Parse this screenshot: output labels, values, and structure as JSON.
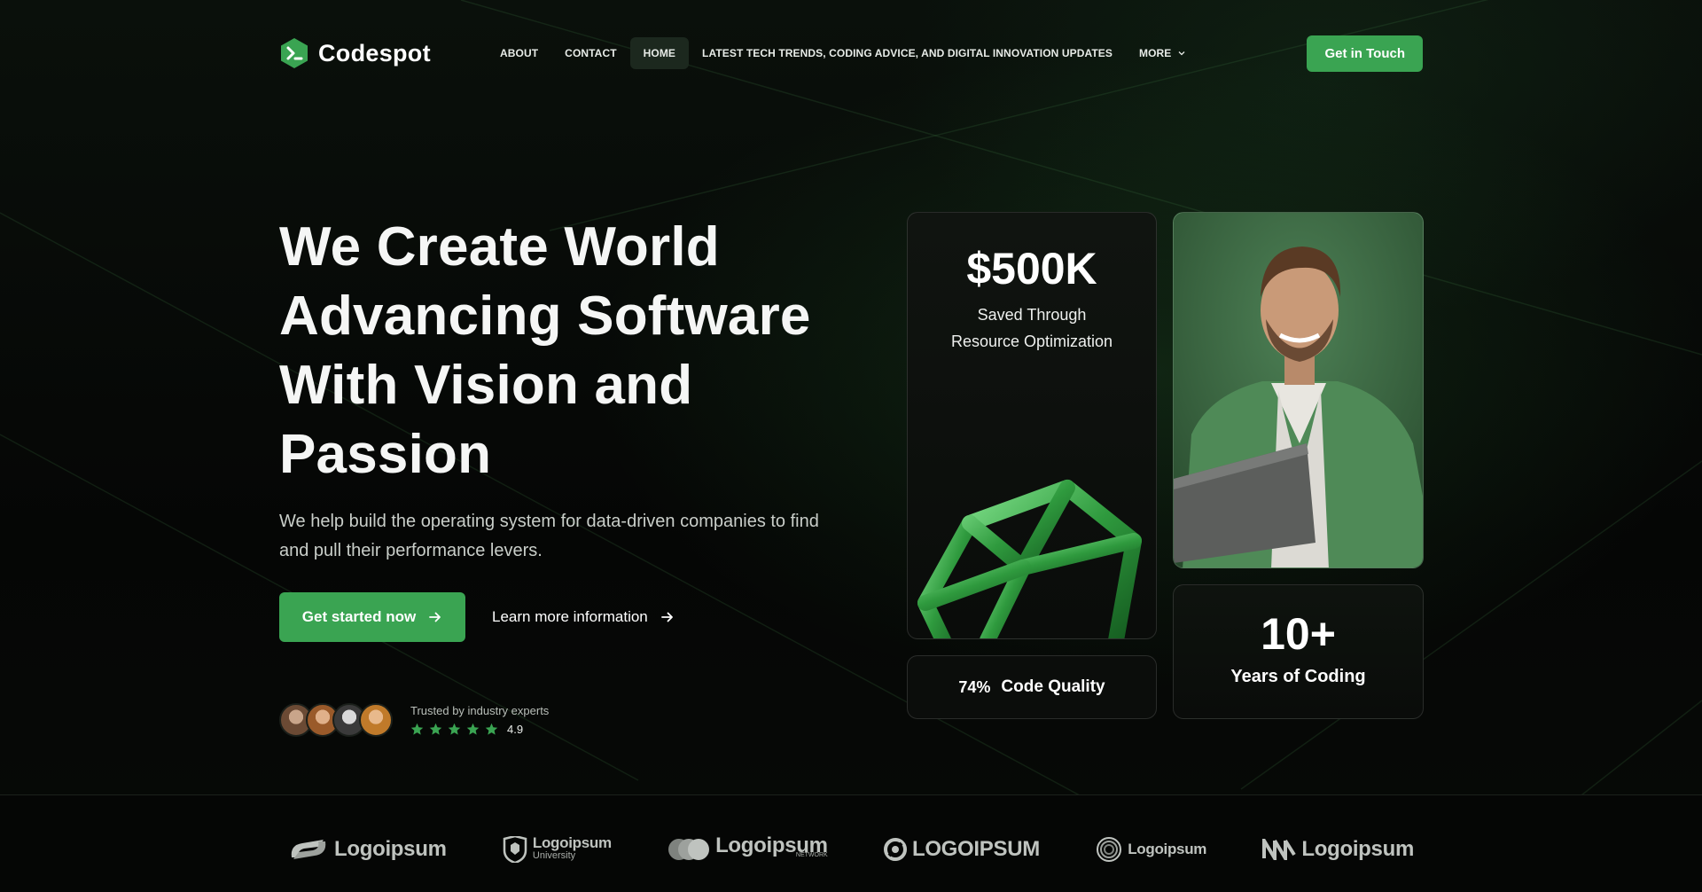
{
  "nav": {
    "logo_text": "Codespot",
    "items": [
      {
        "label": "ABOUT"
      },
      {
        "label": "CONTACT"
      },
      {
        "label": "HOME",
        "active": true
      },
      {
        "label": "LATEST TECH TRENDS, CODING ADVICE, AND DIGITAL INNOVATION UPDATES"
      },
      {
        "label": "MORE"
      }
    ],
    "cta": "Get in Touch"
  },
  "hero": {
    "title_lines": [
      "We Create World",
      "Advancing Software",
      "With Vision and",
      "Passion"
    ],
    "subtitle_lines": [
      "We help build the operating system for data-driven companies to find",
      "and pull their performance levers."
    ],
    "primary_button": "Get started now",
    "secondary_link": "Learn more information",
    "trust_label": "Trusted by industry experts",
    "rating": "4.9",
    "stars": 5
  },
  "stats": {
    "money_value": "$500K",
    "money_label_lines": [
      "Saved Through",
      "Resource Optimization"
    ],
    "quality_pct": "74%",
    "quality_label": "Code Quality",
    "years_value": "10+",
    "years_label": "Years of Coding"
  },
  "partners": [
    {
      "name": "Logoipsum"
    },
    {
      "name": "Logoipsum",
      "sub": "University"
    },
    {
      "name": "Logoipsum",
      "sub": "NETWORK"
    },
    {
      "name": "LOGOIPSUM"
    },
    {
      "name": "Logoipsum"
    },
    {
      "name": "Logoipsum"
    }
  ],
  "colors": {
    "accent": "#3aa452",
    "background": "#050605",
    "active_nav_bg": "#1c281e"
  }
}
